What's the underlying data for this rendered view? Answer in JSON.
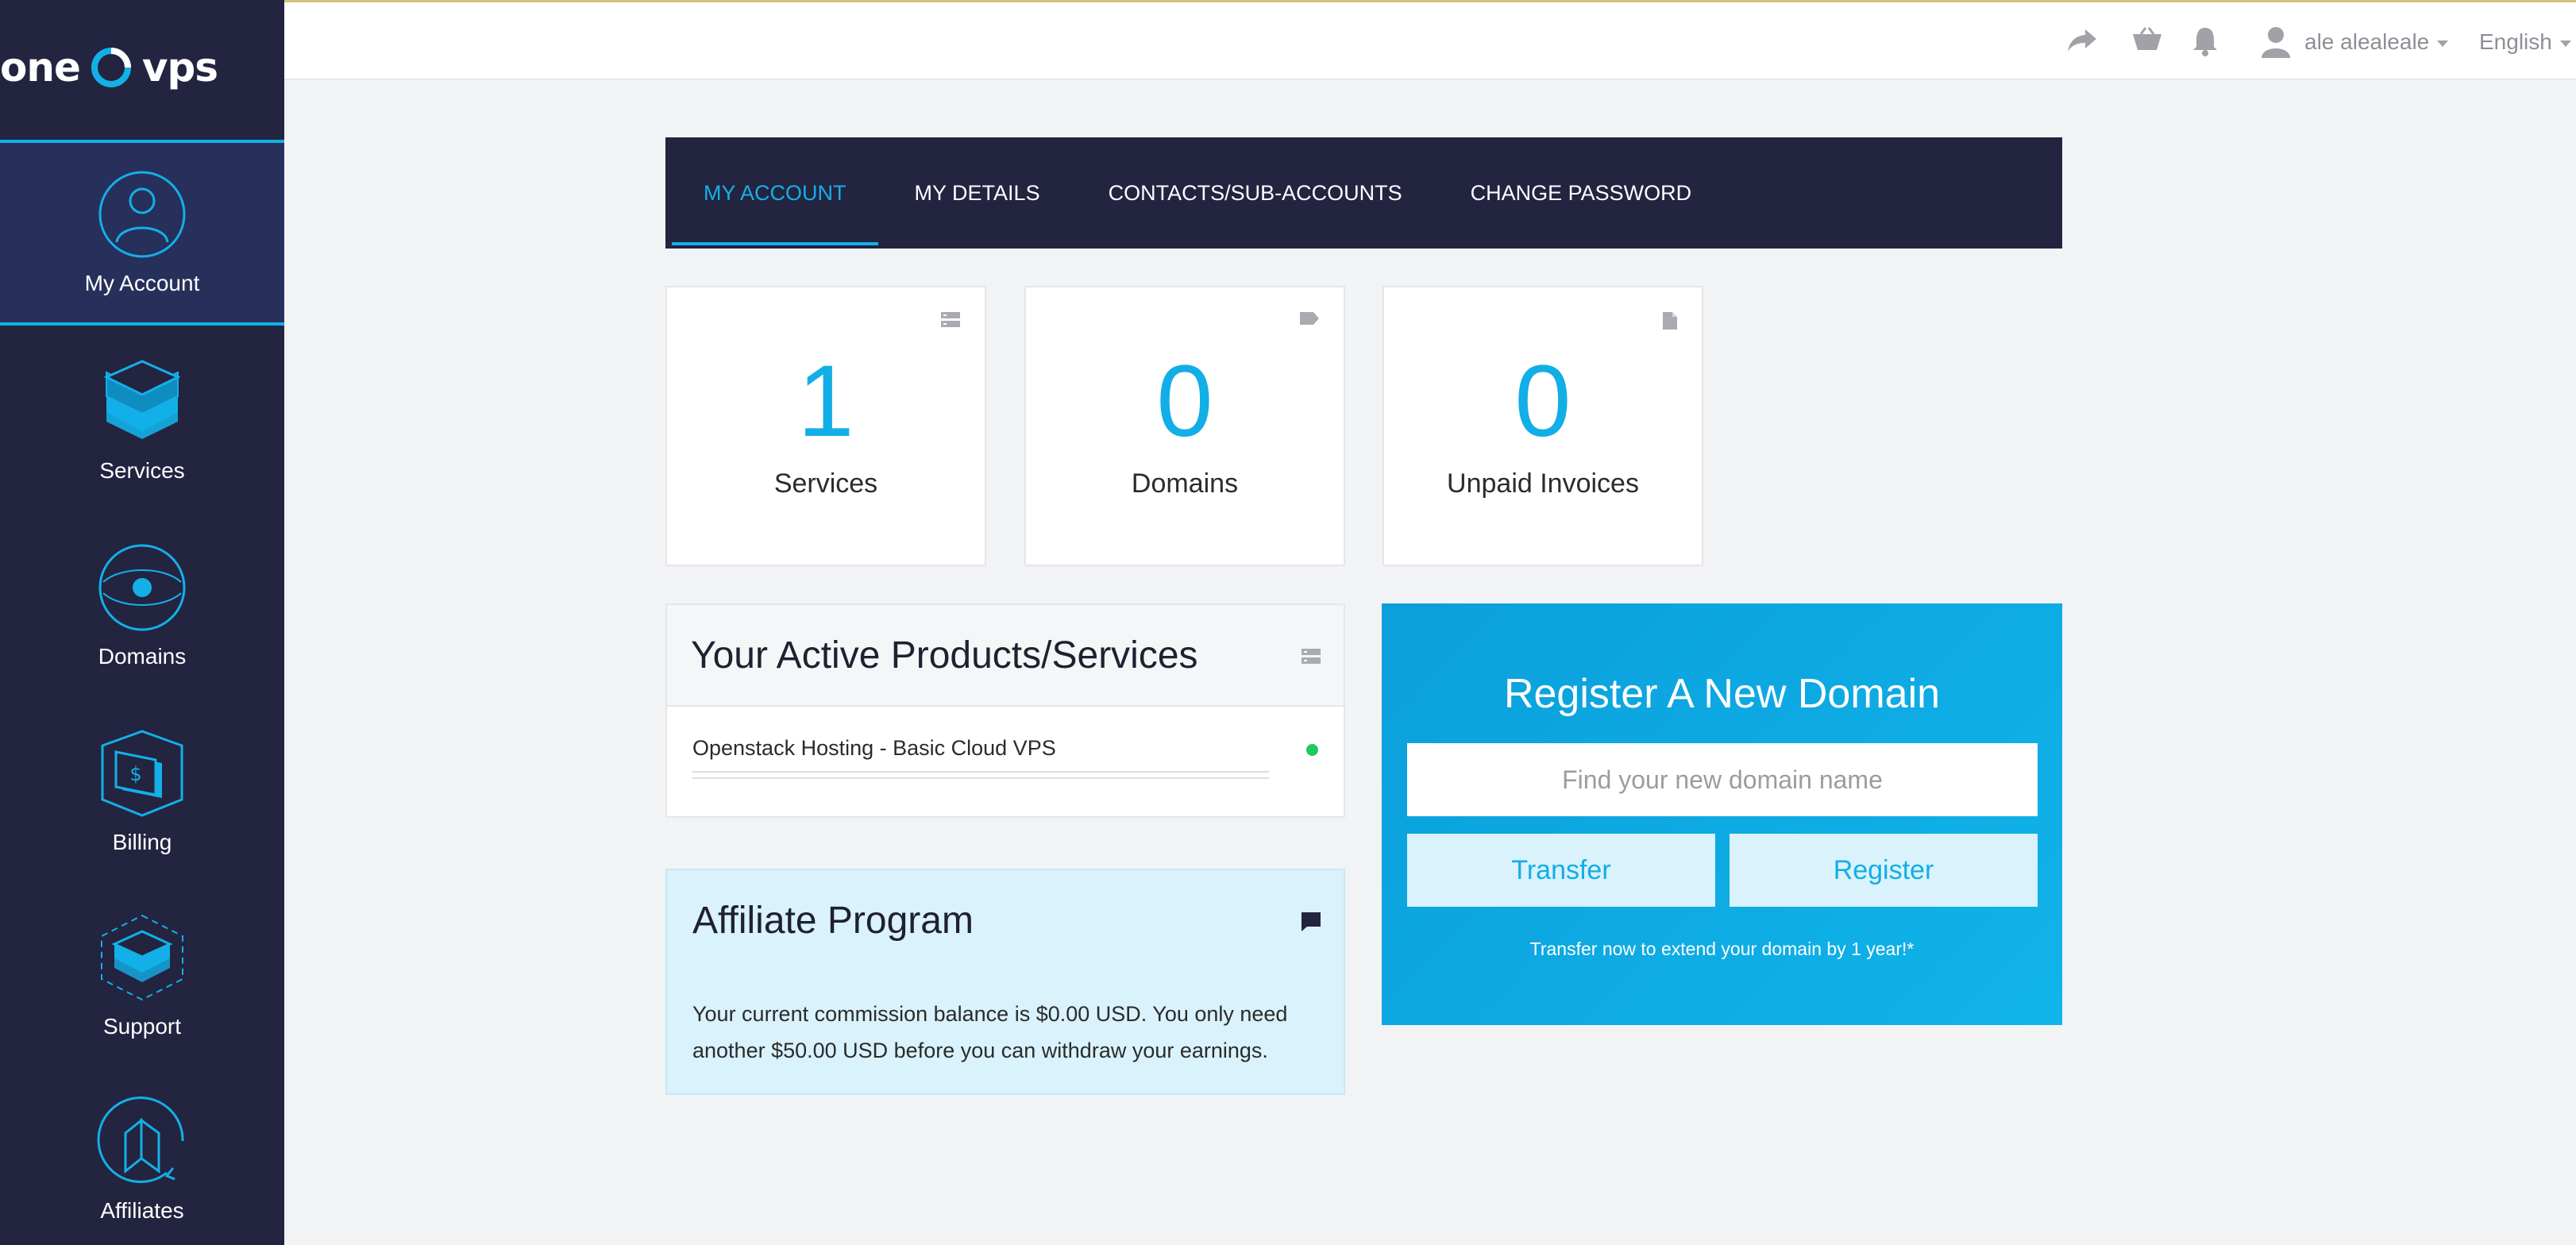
{
  "brand": {
    "logo_left": "one",
    "logo_right": "vps",
    "accent": "#13b0e8",
    "sidebar_bg": "#232440"
  },
  "sidebar": {
    "items": [
      {
        "label": "My Account",
        "icon": "user-circle-icon",
        "active": true
      },
      {
        "label": "Services",
        "icon": "stacked-layers-icon",
        "active": false
      },
      {
        "label": "Domains",
        "icon": "globe-dot-icon",
        "active": false
      },
      {
        "label": "Billing",
        "icon": "billing-shield-icon",
        "active": false
      },
      {
        "label": "Support",
        "icon": "support-layers-icon",
        "active": false
      },
      {
        "label": "Affiliates",
        "icon": "affiliates-refresh-icon",
        "active": false
      }
    ]
  },
  "topbar": {
    "icons": [
      "share-icon",
      "cart-icon",
      "bell-icon",
      "user-icon"
    ],
    "username": "ale alealeale",
    "language": "English"
  },
  "tabs": [
    {
      "label": "MY ACCOUNT",
      "active": true
    },
    {
      "label": "MY DETAILS",
      "active": false
    },
    {
      "label": "CONTACTS/SUB-ACCOUNTS",
      "active": false
    },
    {
      "label": "CHANGE PASSWORD",
      "active": false
    }
  ],
  "stats": [
    {
      "value": "1",
      "label": "Services",
      "icon": "server-icon"
    },
    {
      "value": "0",
      "label": "Domains",
      "icon": "tag-icon"
    },
    {
      "value": "0",
      "label": "Unpaid Invoices",
      "icon": "document-icon"
    }
  ],
  "products": {
    "title": "Your Active Products/Services",
    "items": [
      {
        "name": "Openstack Hosting - Basic Cloud VPS",
        "status_color": "#1fc95f"
      }
    ]
  },
  "affiliate": {
    "title": "Affiliate Program",
    "text": "Your current commission balance is $0.00 USD. You only need another $50.00 USD before you can withdraw your earnings."
  },
  "domain": {
    "title": "Register A New Domain",
    "placeholder": "Find your new domain name",
    "transfer_label": "Transfer",
    "register_label": "Register",
    "note": "Transfer now to extend your domain by 1 year!*"
  }
}
